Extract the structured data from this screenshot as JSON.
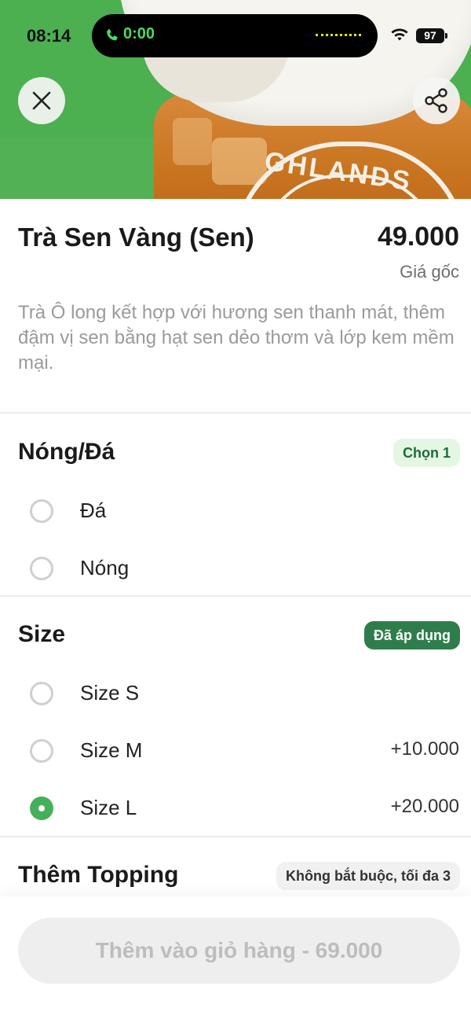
{
  "status_bar": {
    "time": "08:14",
    "call_duration": "0:00",
    "battery": "97"
  },
  "colors": {
    "hero_green": "#4caf50",
    "accent_green": "#45b05a",
    "badge_dark_green": "#2f7d4c",
    "badge_light_green": "#e3f7e3"
  },
  "icons": {
    "close": "close-icon",
    "share": "share-icon",
    "call": "phone-icon",
    "wifi": "wifi-icon"
  },
  "product": {
    "name": "Trà Sen Vàng (Sen)",
    "price": "49.000",
    "price_note": "Giá gốc",
    "description": "Trà Ô long kết hợp với hương sen thanh mát, thêm đậm vị sen bằng hạt sen dẻo thơm và lớp kem mềm mại.",
    "hero_logo_text": "GHLANDS"
  },
  "sections": {
    "temperature": {
      "title": "Nóng/Đá",
      "badge": "Chọn 1",
      "options": [
        {
          "label": "Đá",
          "price": "",
          "selected": false
        },
        {
          "label": "Nóng",
          "price": "",
          "selected": false
        }
      ]
    },
    "size": {
      "title": "Size",
      "badge": "Đã áp dụng",
      "options": [
        {
          "label": "Size S",
          "price": "",
          "selected": false
        },
        {
          "label": "Size M",
          "price": "+10.000",
          "selected": false
        },
        {
          "label": "Size L",
          "price": "+20.000",
          "selected": true
        }
      ]
    },
    "topping": {
      "title": "Thêm Topping",
      "badge": "Không bắt buộc, tối đa 3"
    }
  },
  "cta": {
    "label": "Thêm vào giỏ hàng - 69.000"
  }
}
